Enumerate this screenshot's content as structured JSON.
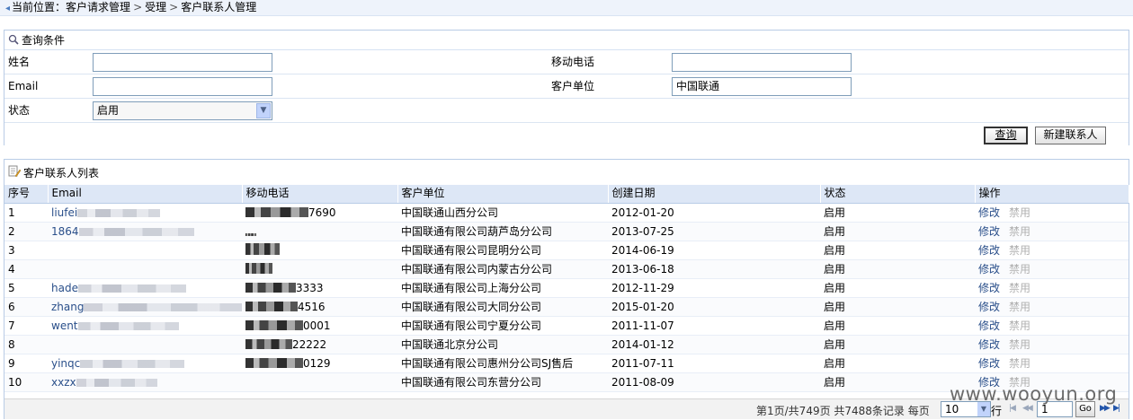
{
  "breadcrumb": {
    "prefix": "当前位置：",
    "items": [
      "客户请求管理",
      "受理",
      "客户联系人管理"
    ]
  },
  "query": {
    "title": "查询条件",
    "fields": {
      "name_label": "姓名",
      "name_value": "",
      "email_label": "Email",
      "email_value": "",
      "status_label": "状态",
      "status_value": "启用",
      "mobile_label": "移动电话",
      "mobile_value": "",
      "company_label": "客户单位",
      "company_value": "中国联通"
    },
    "search_button": "查询",
    "new_button": "新建联系人"
  },
  "list": {
    "title": "客户联系人列表",
    "columns": [
      "序号",
      "Email",
      "移动电话",
      "客户单位",
      "创建日期",
      "状态",
      "操作"
    ],
    "rows": [
      {
        "no": "1",
        "email": "liufei",
        "mobile": "7690",
        "company": "中国联通山西分公司",
        "date": "2012-01-20",
        "status": "启用"
      },
      {
        "no": "2",
        "email": "1864",
        "mobile": "",
        "company": "中国联通有限公司葫芦岛分公司",
        "date": "2013-07-25",
        "status": "启用"
      },
      {
        "no": "3",
        "email": "",
        "mobile": "",
        "company": "中国联通有限公司昆明分公司",
        "date": "2014-06-19",
        "status": "启用"
      },
      {
        "no": "4",
        "email": "",
        "mobile": "",
        "company": "中国联通有限公司内蒙古分公司",
        "date": "2013-06-18",
        "status": "启用"
      },
      {
        "no": "5",
        "email": "hade",
        "mobile": "3333",
        "company": "中国联通有限公司上海分公司",
        "date": "2012-11-29",
        "status": "启用"
      },
      {
        "no": "6",
        "email": "zhang",
        "mobile": "4516",
        "company": "中国联通有限公司大同分公司",
        "date": "2015-01-20",
        "status": "启用"
      },
      {
        "no": "7",
        "email": "went",
        "mobile": "0001",
        "company": "中国联通有限公司宁夏分公司",
        "date": "2011-11-07",
        "status": "启用"
      },
      {
        "no": "8",
        "email": "",
        "mobile": "22222",
        "company": "中国联通北京分公司",
        "date": "2014-01-12",
        "status": "启用"
      },
      {
        "no": "9",
        "email": "yinqc",
        "mobile": "0129",
        "company": "中国联通有限公司惠州分公司SJ售后",
        "date": "2011-07-11",
        "status": "启用"
      },
      {
        "no": "10",
        "email": "xxzx",
        "mobile": "",
        "company": "中国联通有限公司东营分公司",
        "date": "2011-08-09",
        "status": "启用"
      }
    ],
    "action_edit": "修改",
    "action_disable": "禁用"
  },
  "pager": {
    "info": "第1页/共749页  共7488条记录  每页",
    "page_size": "10",
    "rows_unit": "行",
    "current_page": "1",
    "go_label": "Go"
  },
  "watermark": "www.wooyun.org"
}
